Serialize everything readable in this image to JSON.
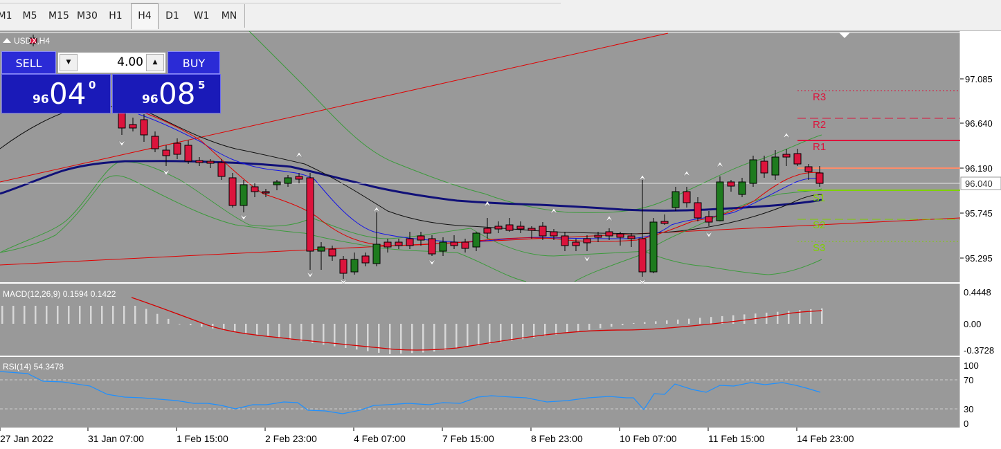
{
  "timeframes": [
    "M1",
    "M5",
    "M15",
    "M30",
    "H1",
    "H4",
    "D1",
    "W1",
    "MN"
  ],
  "active_timeframe": "H4",
  "chart_title": "USDX,H4",
  "trade_panel": {
    "sell_label": "SELL",
    "buy_label": "BUY",
    "lot_value": "4.00",
    "sell_price_small": "96",
    "sell_price_big": "04",
    "sell_price_sup": "0",
    "buy_price_small": "96",
    "buy_price_big": "08",
    "buy_price_sup": "5"
  },
  "price_axis": {
    "ticks": [
      "97.085",
      "96.640",
      "96.190",
      "95.745",
      "95.295"
    ],
    "current_price": "96.040"
  },
  "pivot_labels": [
    "R3",
    "R2",
    "R1",
    "S1",
    "S2",
    "S3"
  ],
  "macd": {
    "label": "MACD(12,26,9) 0.1594 0.1422",
    "ticks": [
      "0.4448",
      "0.00",
      "-0.3728"
    ]
  },
  "rsi": {
    "label": "RSI(14) 54.3478",
    "ticks": [
      "100",
      "70",
      "30",
      "0"
    ]
  },
  "time_axis": [
    "27 Jan 2022",
    "31 Jan 07:00",
    "1 Feb 15:00",
    "2 Feb 23:00",
    "4 Feb 07:00",
    "7 Feb 15:00",
    "8 Feb 23:00",
    "10 Feb 07:00",
    "11 Feb 15:00",
    "14 Feb 23:00"
  ],
  "colors": {
    "chart_bg": "#999999",
    "bull": "#1e7b1e",
    "bear": "#dc143c",
    "trendline": "#e00000",
    "ma_slow": "#101078",
    "ma_fast": "#1414e6",
    "signal": "#d40000",
    "rsi_line": "#1e90ff",
    "pivot_r": "#dc143c",
    "pivot_s": "#7fd000",
    "pivot_mid": "#ff8c69"
  },
  "chart_data": {
    "type": "candlestick",
    "symbol": "USDX",
    "timeframe": "H4",
    "price_ticks": [
      97.085,
      96.64,
      96.19,
      95.745,
      95.295
    ],
    "current_price": 96.04,
    "macd_ticks": [
      0.4448,
      0.0,
      -0.3728
    ],
    "rsi_ticks": [
      100,
      70,
      30,
      0
    ]
  }
}
